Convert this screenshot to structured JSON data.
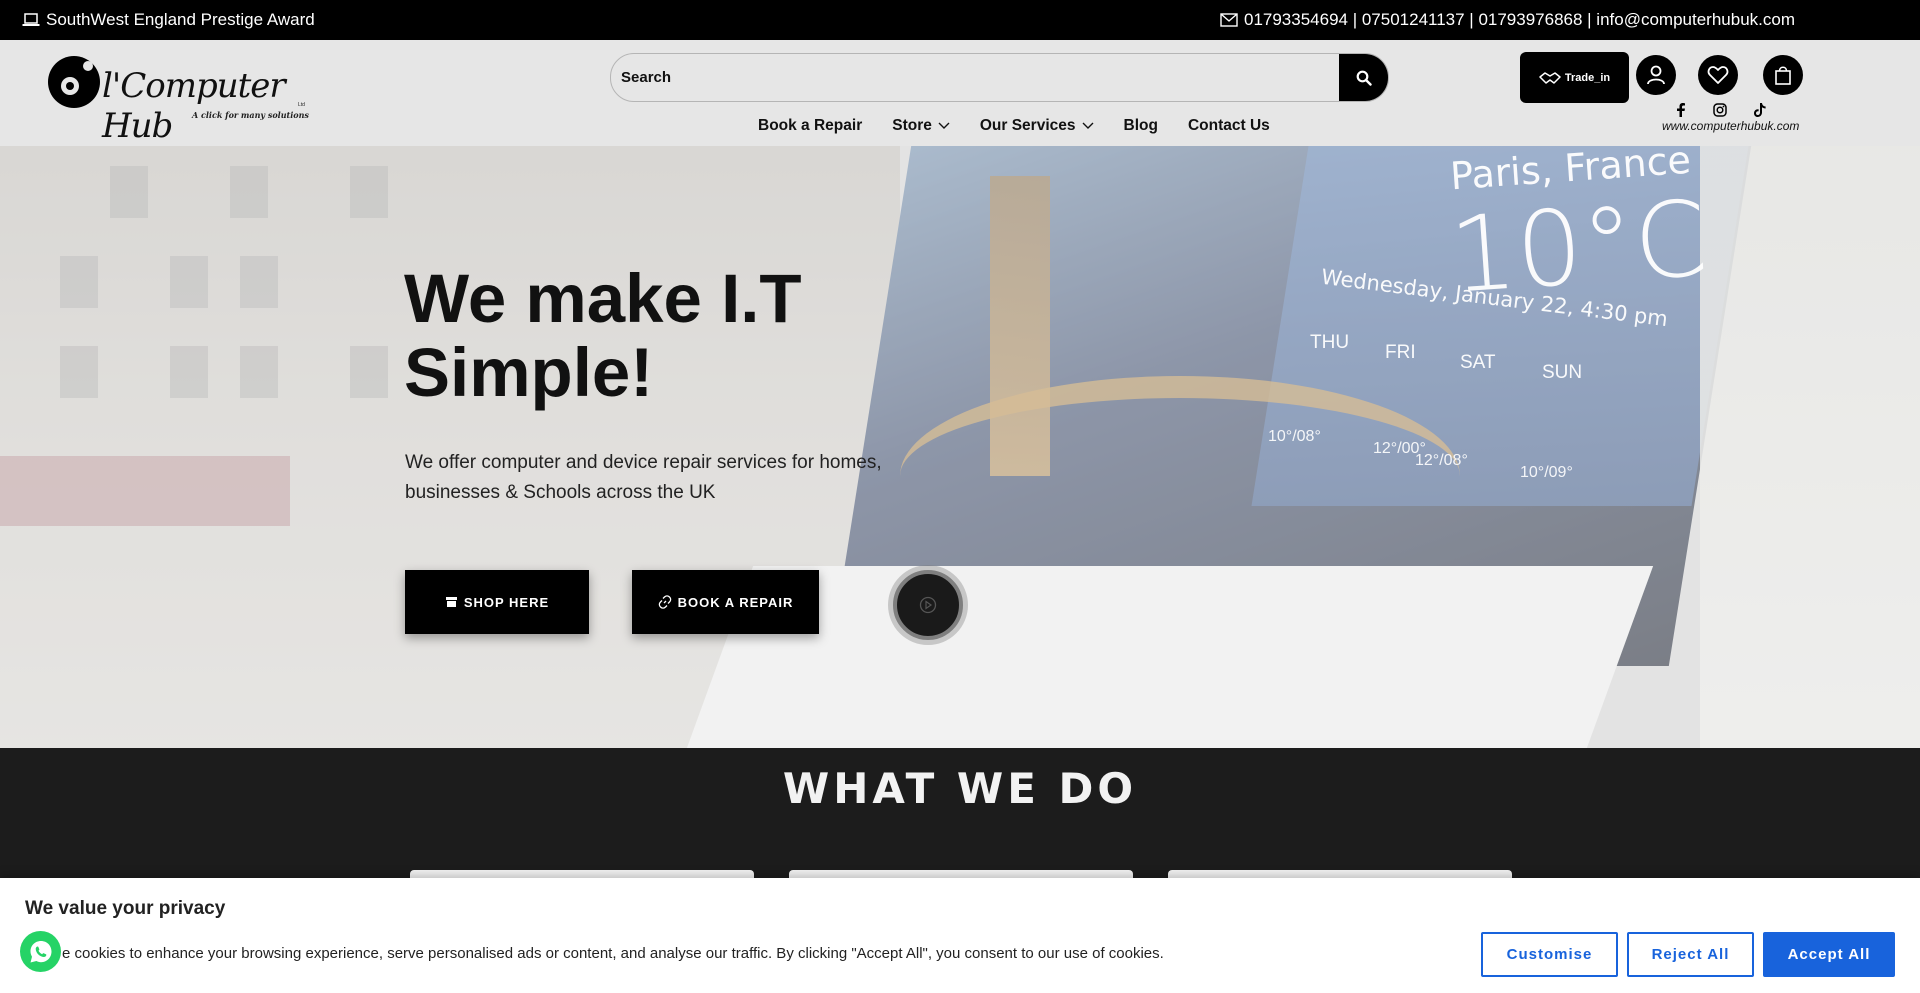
{
  "topbar": {
    "award_text": "SouthWest England Prestige Award",
    "contact_text": "01793354694 | 07501241137 | 01793976868 | info@computerhubuk.com"
  },
  "header": {
    "logo": {
      "brand": "l'Computer Hub",
      "tagline": "A click for many solutions",
      "suffix": "Ltd"
    },
    "search": {
      "placeholder": "Search",
      "value": ""
    },
    "trade_label": "Trade_in",
    "nav": [
      {
        "label": "Book a Repair"
      },
      {
        "label": "Store"
      },
      {
        "label": "Our Services"
      },
      {
        "label": "Blog"
      },
      {
        "label": "Contact Us"
      }
    ],
    "site_url": "www.computerhubuk.com"
  },
  "hero": {
    "title": "We make I.T Simple!",
    "subtitle": "We offer computer and device repair services for homes, businesses & Schools across the UK",
    "shop_button": "SHOP HERE",
    "repair_button": "BOOK A REPAIR",
    "weather": {
      "city": "Paris, France",
      "temp": "10°C",
      "date": "Wednesday, January 22, 4:30 pm",
      "days": [
        {
          "day": "THU",
          "range": "10°/08°"
        },
        {
          "day": "FRI",
          "range": "12°/00°"
        },
        {
          "day": "SAT",
          "range": "12°/08°"
        },
        {
          "day": "SUN",
          "range": "10°/09°"
        }
      ]
    }
  },
  "what_we_do": {
    "title": "WHAT WE DO"
  },
  "cookie": {
    "title": "We value your privacy",
    "text": "e cookies to enhance your browsing experience, serve personalised ads or content, and analyse our traffic. By clicking \"Accept All\", you consent to our use of cookies.",
    "customise": "Customise",
    "reject": "Reject All",
    "accept": "Accept All"
  },
  "colors": {
    "accent_blue": "#1863dc",
    "whatsapp_green": "#25d366",
    "topbar_bg": "#000000",
    "header_bg": "#e6e6e6",
    "section_dark": "#1c1c1c"
  }
}
